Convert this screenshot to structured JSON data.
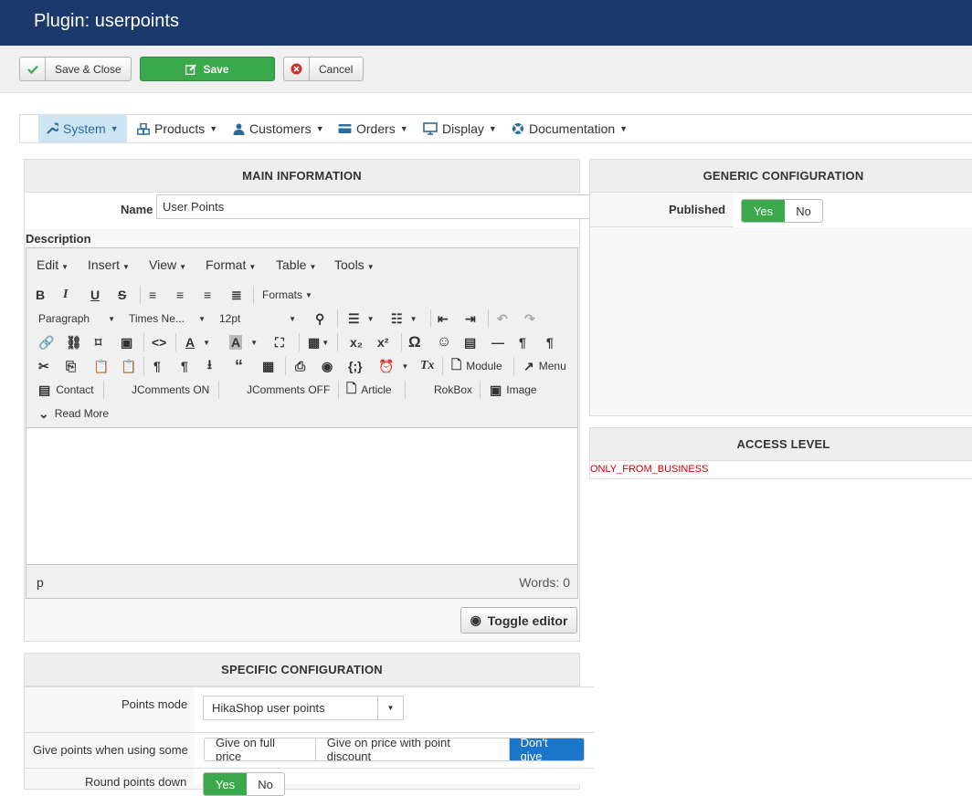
{
  "header": {
    "title": "Plugin: userpoints"
  },
  "toolbar": {
    "save_close": "Save & Close",
    "save": "Save",
    "cancel": "Cancel"
  },
  "menu": [
    {
      "label": "System",
      "icon": "wrench-icon"
    },
    {
      "label": "Products",
      "icon": "cubes-icon"
    },
    {
      "label": "Customers",
      "icon": "user-icon"
    },
    {
      "label": "Orders",
      "icon": "credit-card-icon"
    },
    {
      "label": "Display",
      "icon": "monitor-icon"
    },
    {
      "label": "Documentation",
      "icon": "lifebuoy-icon"
    }
  ],
  "main": {
    "heading": "MAIN INFORMATION",
    "name_label": "Name",
    "name_value": "User Points",
    "description_label": "Description"
  },
  "editor": {
    "menus": [
      "Edit",
      "Insert",
      "View",
      "Format",
      "Table",
      "Tools"
    ],
    "formats": "Formats",
    "paragraph": "Paragraph",
    "font": "Times Ne...",
    "size": "12pt",
    "module": "Module",
    "menu_btn": "Menu",
    "contact": "Contact",
    "jcomments_on": "JComments ON",
    "jcomments_off": "JComments OFF",
    "article": "Article",
    "rokbox": "RokBox",
    "image": "Image",
    "readmore": "Read More",
    "status_path": "p",
    "words": "Words: 0",
    "toggle": "Toggle editor"
  },
  "generic": {
    "heading": "GENERIC CONFIGURATION",
    "published_label": "Published",
    "yes": "Yes",
    "no": "No"
  },
  "access": {
    "heading": "ACCESS LEVEL",
    "value": "ONLY_FROM_BUSINESS",
    "value_color": "#d00000"
  },
  "specific": {
    "heading": "SPECIFIC CONFIGURATION",
    "points_mode_label": "Points mode",
    "points_mode_value": "HikaShop user points",
    "give_points_label": "Give points when using some",
    "give_options": [
      "Give on full price",
      "Give on price with point discount",
      "Don't give"
    ],
    "round_label": "Round points down",
    "yes": "Yes",
    "no": "No"
  },
  "colors": {
    "header_bg": "#1b3a6b",
    "save_green": "#3aa94b",
    "active_blue": "#1b76c9"
  }
}
